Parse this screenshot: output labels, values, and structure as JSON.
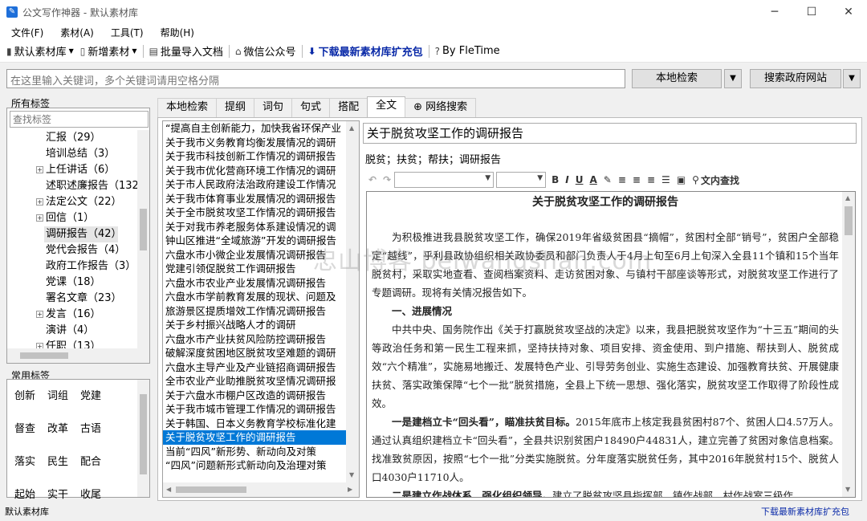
{
  "window": {
    "title": "公文写作神器 - 默认素材库",
    "minimize": "─",
    "maximize": "☐",
    "close": "✕"
  },
  "menu": [
    "文件(F)",
    "素材(A)",
    "工具(T)",
    "帮助(H)"
  ],
  "toolbar": {
    "library": "默认素材库",
    "new_material": "新增素材",
    "batch_import": "批量导入文档",
    "wechat": "微信公众号",
    "download": "下载最新素材库扩充包",
    "by": "By FleTime"
  },
  "search": {
    "placeholder": "在这里输入关键词，多个关键词请用空格分隔",
    "local_button": "本地检索",
    "gov_button": "搜索政府网站"
  },
  "tags_panel": {
    "label": "所有标签",
    "search_placeholder": "查找标签",
    "items": [
      {
        "label": "汇报（29）",
        "expander": ""
      },
      {
        "label": "培训总结（3）",
        "expander": ""
      },
      {
        "label": "上任讲话（6）",
        "expander": "+"
      },
      {
        "label": "述职述廉报告（132",
        "expander": ""
      },
      {
        "label": "法定公文（22）",
        "expander": "+"
      },
      {
        "label": "回信（1）",
        "expander": "+"
      },
      {
        "label": "调研报告（42）",
        "expander": "",
        "selected": true
      },
      {
        "label": "党代会报告（4）",
        "expander": ""
      },
      {
        "label": "政府工作报告（3）",
        "expander": ""
      },
      {
        "label": "党课（18）",
        "expander": ""
      },
      {
        "label": "署名文章（23）",
        "expander": ""
      },
      {
        "label": "发言（16）",
        "expander": "+"
      },
      {
        "label": "演讲（4）",
        "expander": ""
      },
      {
        "label": "任职（13）",
        "expander": "+"
      }
    ]
  },
  "common_tags": {
    "label": "常用标签",
    "rows": [
      [
        "创新",
        "词组",
        "党建"
      ],
      [
        "督查",
        "改革",
        "古语"
      ],
      [
        "落实",
        "民生",
        "配合"
      ],
      [
        "起始",
        "实干",
        "收尾"
      ]
    ]
  },
  "tabs": [
    "本地检索",
    "提纲",
    "词句",
    "句式",
    "搭配",
    "全文",
    "网络搜索"
  ],
  "active_tab": "全文",
  "doc_list": [
    "“提高自主创新能力，加快我省环保产业",
    "关于我市义务教育均衡发展情况的调研",
    "关于我市科技创新工作情况的调研报告",
    "关于我市优化营商环境工作情况的调研",
    "关于市人民政府法治政府建设工作情况",
    "关于我市体育事业发展情况的调研报告",
    "关于全市脱贫攻坚工作情况的调研报告",
    "关于对我市养老服务体系建设情况的调",
    "钟山区推进“全域旅游”开发的调研报告",
    "六盘水市小微企业发展情况调研报告",
    "党建引领促脱贫工作调研报告",
    "六盘水市农业产业发展情况调研报告",
    "六盘水市学前教育发展的现状、问题及",
    "旅游景区提质增效工作情况调研报告",
    "关于乡村振兴战略人才的调研",
    "六盘水市产业扶贫风险防控调研报告",
    "破解深度贫困地区脱贫攻坚难题的调研",
    "六盘水主导产业及产业链招商调研报告",
    "全市农业产业助推脱贫攻坚情况调研报",
    "关于六盘水市棚户区改造的调研报告",
    "关于我市城市管理工作情况的调研报告",
    "关于韩国、日本义务教育学校标准化建",
    "关于脱贫攻坚工作的调研报告",
    "当前“四风”新形势、新动向及对策",
    "“四风”问题新形式新动向及治理对策"
  ],
  "selected_doc_index": 22,
  "document": {
    "title": "关于脱贫攻坚工作的调研报告",
    "keywords": "脱贫；扶贫；帮扶；调研报告",
    "find_label": "文内查找",
    "heading": "关于脱贫攻坚工作的调研报告",
    "paragraphs": [
      {
        "bold": "",
        "text": "为积极推进我县脱贫攻坚工作，确保2019年省级贫困县“摘帽”，贫困村全部“销号”，贫困户全部稳定“越线”，乎利县政协组织相关政协委员和部门负责人于4月上旬至6月上旬深入全县11个镇和15个当年脱贫村，采取实地查看、查阅档案资料、走访贫困对象、与镇村干部座谈等形式，对脱贫攻坚工作进行了专题调研。现将有关情况报告如下。"
      },
      {
        "bold": "一、进展情况",
        "text": ""
      },
      {
        "bold": "",
        "text": "中共中央、国务院作出《关于打赢脱贫攻坚战的决定》以来，我县把脱贫攻坚作为“十三五”期间的头等政治任务和第一民生工程来抓，坚持扶持对象、项目安排、资金使用、到户措施、帮扶到人、脱贫成效“六个精准”，实施易地搬迁、发展特色产业、引导劳务创业、实施生态建设、加强教育扶贫、开展健康扶贫、落实政策保障“七个一批”脱贫措施，全县上下统一思想、强化落实，脱贫攻坚工作取得了阶段性成效。"
      },
      {
        "bold": "一是建档立卡“回头看”，瞄准扶贫目标。",
        "text": "2015年底市上核定我县贫困村87个、贫困人口4.57万人。通过认真组织建档立卡“回头看”，全县共识别贫困户18490户44831人，建立完善了贫困对象信息档案。找准致贫原因，按照“七个一批”分类实施脱贫。分年度落实脱贫任务，其中2016年脱贫村15个、脱贫人口4030户11710人。"
      },
      {
        "bold": "二是建立作战体系，强化组织领导。",
        "text": "建立了脱贫攻坚县指挥部、镇作战部、村作战室三级作"
      }
    ]
  },
  "watermark": "忠山博客 beiwangshan.com",
  "status": {
    "left": "默认素材库",
    "right": "下载最新素材库扩充包"
  },
  "colors": {
    "selection": "#0078d7",
    "link": "#0a2aa8"
  }
}
